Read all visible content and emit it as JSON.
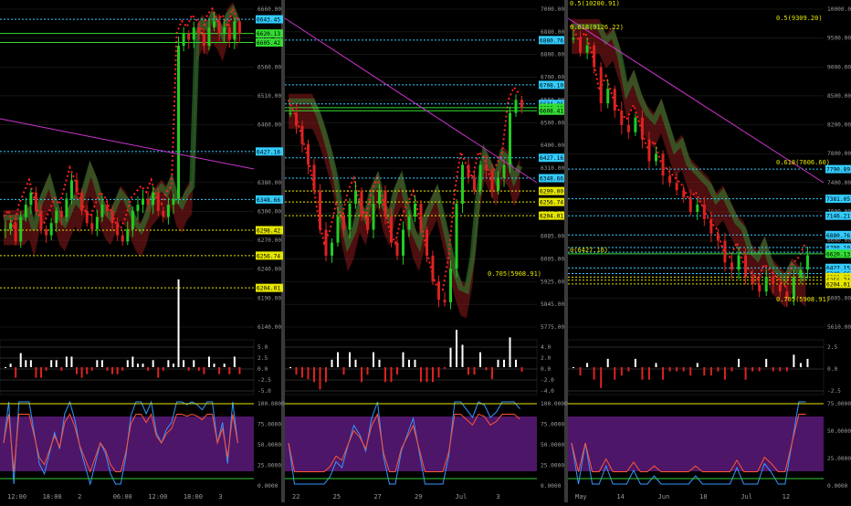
{
  "colors": {
    "background": "#000000",
    "grid": "#2a2a2a",
    "bull": "#22cc22",
    "bear": "#dd2222",
    "cyan_line": "#33ccff",
    "yellow_line": "#e6e600",
    "magenta_line": "#cc33cc",
    "red_dotted": "#ff2222",
    "cloud_green": "#2e7d32",
    "cloud_red": "#8b1a1a",
    "stoch_band": "#5a1a7a",
    "label_cyan": "#33ccff",
    "label_yellow": "#e6e600",
    "label_green": "#33dd33"
  },
  "chart_data": [
    {
      "type": "line",
      "panel": "1H",
      "price_axis": {
        "ticks": [
          "6660.00",
          "6610.00",
          "6560.00",
          "6510.00",
          "6460.00",
          "6420.00",
          "6380.00",
          "6300.00",
          "6270.00",
          "6240.00",
          "6190.00",
          "6140.00"
        ]
      },
      "time_axis": {
        "ticks": [
          "12:00",
          "18:00",
          "2",
          "06:00",
          "12:00",
          "18:00",
          "3"
        ]
      },
      "level_labels": [
        {
          "text": "6643.45",
          "style": "cyan"
        },
        {
          "text": "6620.13",
          "style": "green"
        },
        {
          "text": "6605.42",
          "style": "green"
        },
        {
          "text": "6427.16",
          "style": "cyan"
        },
        {
          "text": "6348.66",
          "style": "cyan"
        },
        {
          "text": "6298.42",
          "style": "yellow"
        },
        {
          "text": "6256.74",
          "style": "yellow"
        },
        {
          "text": "6204.01",
          "style": "yellow"
        }
      ],
      "macd_ticks": [
        "5.0",
        "2.5",
        "0.0",
        "-2.5",
        "-5.0"
      ],
      "stoch_ticks": [
        "100.0000",
        "75.0000",
        "50.0000",
        "25.0000",
        "0.0000"
      ],
      "close": [
        6300,
        6310,
        6280,
        6320,
        6340,
        6360,
        6330,
        6300,
        6290,
        6310,
        6330,
        6320,
        6350,
        6380,
        6360,
        6330,
        6310,
        6300,
        6320,
        6340,
        6330,
        6310,
        6290,
        6280,
        6300,
        6330,
        6340,
        6350,
        6340,
        6360,
        6330,
        6320,
        6340,
        6350,
        6600,
        6620,
        6610,
        6630,
        6620,
        6600,
        6630,
        6640,
        6620,
        6630,
        6610,
        6640,
        6620
      ]
    },
    {
      "type": "line",
      "panel": "4H",
      "price_axis": {
        "ticks": [
          "7000.00",
          "6880.00",
          "6800.00",
          "6700.00",
          "6560.00",
          "6500.00",
          "6400.00",
          "6310.00",
          "6230.00",
          "6160.00",
          "6085.00",
          "6005.00",
          "5925.00",
          "5845.00",
          "5775.00"
        ]
      },
      "time_axis": {
        "ticks": [
          "22",
          "25",
          "27",
          "29",
          "Jul",
          "3"
        ]
      },
      "level_labels": [
        {
          "text": "6880.76",
          "style": "cyan"
        },
        {
          "text": "6708.10",
          "style": "cyan"
        },
        {
          "text": "6634.86",
          "style": "cyan"
        },
        {
          "text": "6620.13",
          "style": "green"
        },
        {
          "text": "6608.41",
          "style": "green"
        },
        {
          "text": "6427.16",
          "style": "cyan"
        },
        {
          "text": "6348.66",
          "style": "cyan"
        },
        {
          "text": "6299.00",
          "style": "yellow"
        },
        {
          "text": "6256.74",
          "style": "yellow"
        },
        {
          "text": "6204.01",
          "style": "yellow"
        }
      ],
      "annotations": [
        "0.705(5908.91)"
      ],
      "macd_ticks": [
        "4.0",
        "2.0",
        "0.0",
        "-2.0",
        "-4.0"
      ],
      "stoch_ticks": [
        "100.0000",
        "75.0000",
        "50.0000",
        "25.0000",
        "0.0000"
      ],
      "close": [
        6600,
        6550,
        6480,
        6400,
        6300,
        6150,
        6050,
        6100,
        6200,
        6150,
        6250,
        6300,
        6200,
        6150,
        6250,
        6300,
        6200,
        6100,
        6050,
        6150,
        6200,
        6250,
        6150,
        6050,
        5950,
        5880,
        5870,
        6000,
        6250,
        6400,
        6350,
        6300,
        6400,
        6380,
        6300,
        6350,
        6400,
        6600,
        6650,
        6620
      ]
    },
    {
      "type": "line",
      "panel": "1D",
      "price_axis": {
        "ticks": [
          "10000.00",
          "9500.00",
          "9000.00",
          "8500.00",
          "8200.00",
          "7800.00",
          "7400.00",
          "7000.00",
          "6600.00",
          "6300.00",
          "6005.00",
          "5610.00"
        ]
      },
      "time_axis": {
        "ticks": [
          "May",
          "14",
          "Jun",
          "18",
          "Jul",
          "12"
        ]
      },
      "level_labels": [
        {
          "text": "7790.89",
          "style": "cyan"
        },
        {
          "text": "7381.05",
          "style": "cyan"
        },
        {
          "text": "7146.21",
          "style": "cyan"
        },
        {
          "text": "6880.76",
          "style": "cyan"
        },
        {
          "text": "6708.10",
          "style": "cyan"
        },
        {
          "text": "6643.45",
          "style": "cyan"
        },
        {
          "text": "6620.13",
          "style": "green"
        },
        {
          "text": "6427.15",
          "style": "cyan"
        },
        {
          "text": "6348.66",
          "style": "cyan"
        },
        {
          "text": "6299.00",
          "style": "yellow"
        },
        {
          "text": "6256.74",
          "style": "yellow"
        },
        {
          "text": "6204.01",
          "style": "yellow"
        }
      ],
      "annotations": [
        "0.5(10200.91)",
        "0.5(9309.20)",
        "0.618(9126.22)",
        "0.618(7606.60)",
        "0(6427.16)",
        "0.705(5908.91)"
      ],
      "macd_ticks": [
        "2.5",
        "0.0",
        "-2.5"
      ],
      "stoch_ticks": [
        "75.0000",
        "50.0000",
        "25.0000",
        "0.0000"
      ],
      "close": [
        9600,
        9400,
        9500,
        9200,
        8700,
        8900,
        8600,
        8400,
        8300,
        8500,
        8200,
        7900,
        8000,
        7700,
        7600,
        7500,
        7400,
        7200,
        7300,
        7100,
        6900,
        6800,
        6500,
        6400,
        6600,
        6300,
        6200,
        6100,
        6300,
        6200,
        6100,
        6000,
        6300,
        6400,
        6600
      ]
    }
  ]
}
